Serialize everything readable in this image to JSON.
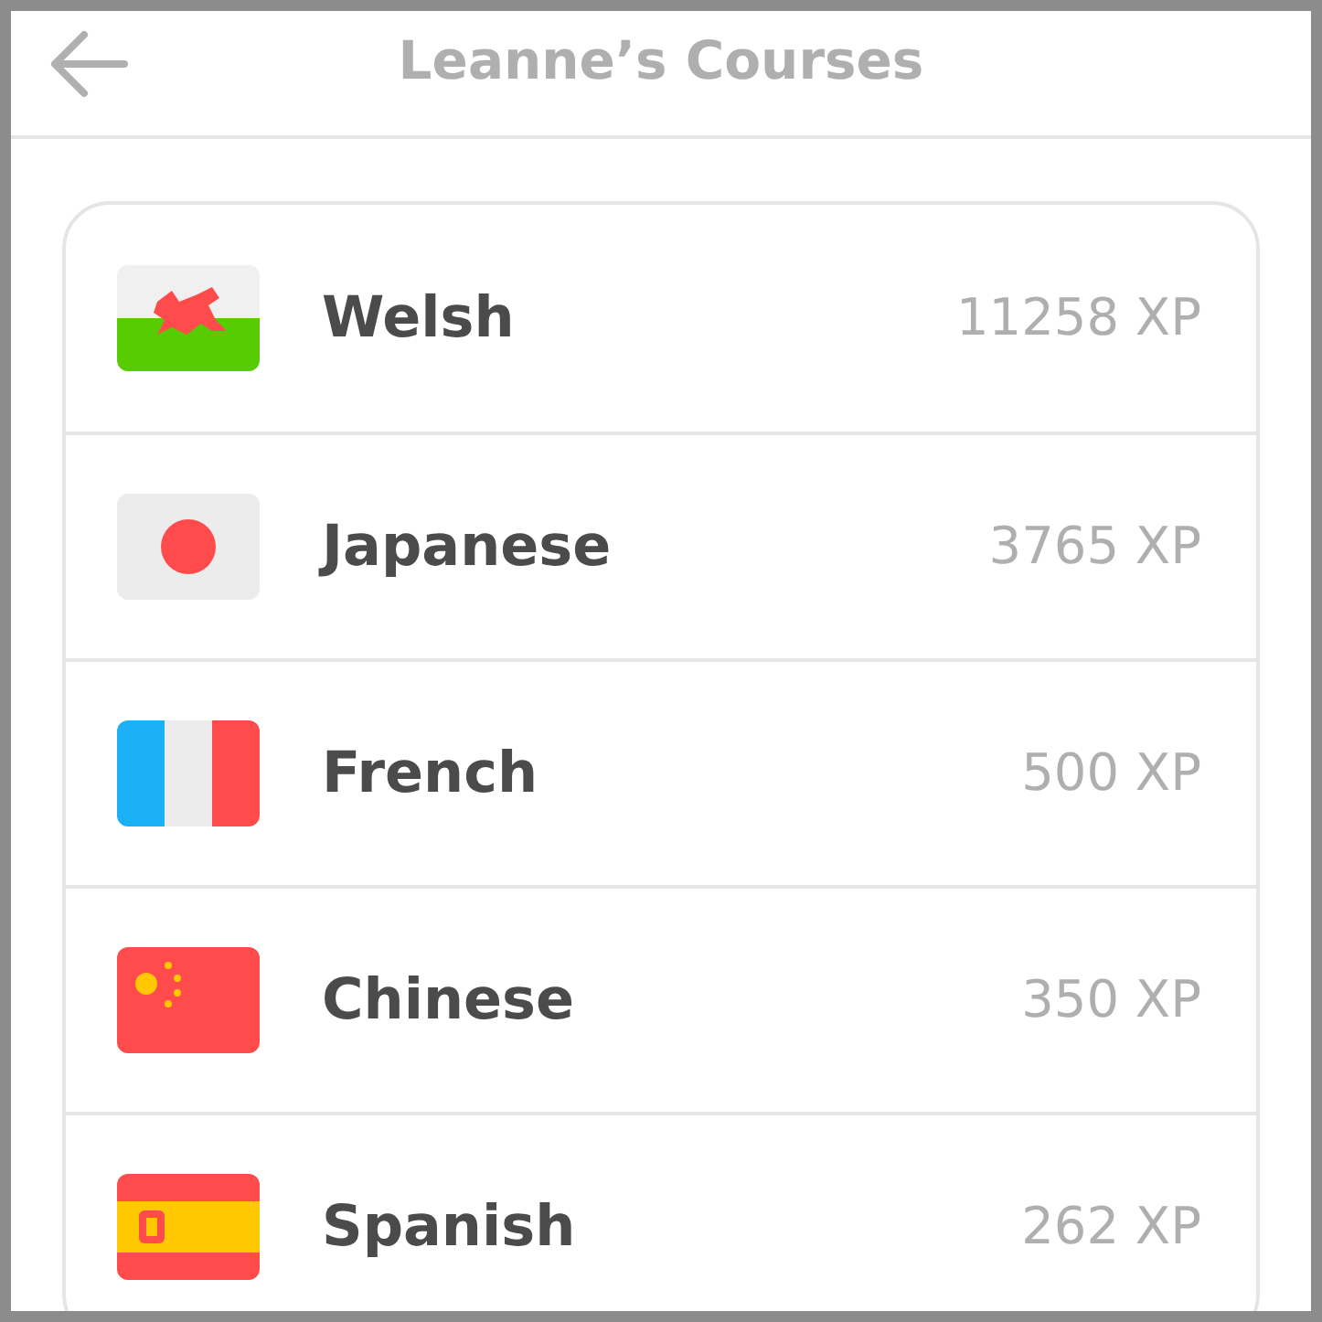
{
  "header": {
    "title": "Leanne’s Courses"
  },
  "courses": [
    {
      "kind": "welsh",
      "name": "Welsh",
      "xp": "11258 XP"
    },
    {
      "kind": "japan",
      "name": "Japanese",
      "xp": "3765 XP"
    },
    {
      "kind": "france",
      "name": "French",
      "xp": "500 XP"
    },
    {
      "kind": "china",
      "name": "Chinese",
      "xp": "350 XP"
    },
    {
      "kind": "spain",
      "name": "Spanish",
      "xp": "262 XP"
    }
  ]
}
